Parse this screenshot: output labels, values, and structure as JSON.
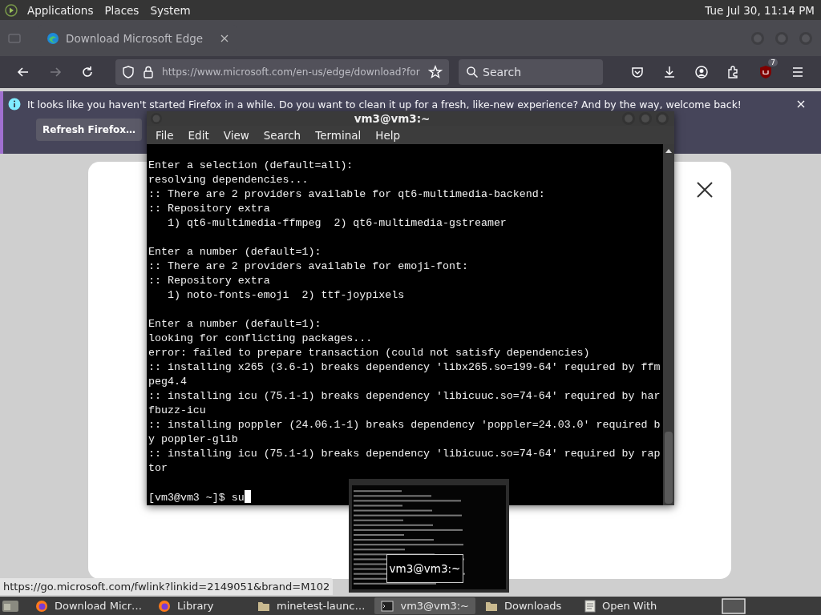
{
  "top_panel": {
    "menus": [
      "Applications",
      "Places",
      "System"
    ],
    "clock": "Tue Jul 30, 11:14 PM"
  },
  "browser": {
    "tabs": [
      {
        "title": "Download Microsoft Edge",
        "selected": true
      }
    ],
    "url": "https://www.microsoft.com/en-us/edge/download?for",
    "search": {
      "placeholder": "Search"
    },
    "forward_disabled": true,
    "extension_badge": "7",
    "notification": {
      "message": "It looks like you haven't started Firefox in a while. Do you want to clean it up for a fresh, like-new experience? And by the way, welcome back!",
      "button": "Refresh Firefox…"
    },
    "status_url": "https://go.microsoft.com/fwlink?linkid=2149051&brand=M102"
  },
  "terminal": {
    "title": "vm3@vm3:~",
    "menus": [
      "File",
      "Edit",
      "View",
      "Search",
      "Terminal",
      "Help"
    ],
    "blocks": [
      [
        "Enter a selection (default=all):",
        "resolving dependencies...",
        ":: There are 2 providers available for qt6-multimedia-backend:",
        ":: Repository extra",
        "   1) qt6-multimedia-ffmpeg  2) qt6-multimedia-gstreamer"
      ],
      [
        "Enter a number (default=1):",
        ":: There are 2 providers available for emoji-font:",
        ":: Repository extra",
        "   1) noto-fonts-emoji  2) ttf-joypixels"
      ],
      [
        "Enter a number (default=1):",
        "looking for conflicting packages...",
        "error: failed to prepare transaction (could not satisfy dependencies)",
        ":: installing x265 (3.6-1) breaks dependency 'libx265.so=199-64' required by ffm",
        "peg4.4",
        ":: installing icu (75.1-1) breaks dependency 'libicuuc.so=74-64' required by har",
        "fbuzz-icu",
        ":: installing poppler (24.06.1-1) breaks dependency 'poppler=24.03.0' required b",
        "y poppler-glib",
        ":: installing icu (75.1-1) breaks dependency 'libicuuc.so=74-64' required by rap",
        "tor"
      ]
    ],
    "prompt": "[vm3@vm3 ~]$ ",
    "input": "su"
  },
  "switcher_preview": {
    "label": "vm3@vm3:~"
  },
  "taskbar": {
    "items": [
      {
        "label": "Download Micr…",
        "kind": "firefox",
        "selected": false
      },
      {
        "label": "Library",
        "kind": "firefox",
        "selected": false
      },
      {
        "label": "minetest-launc…",
        "kind": "folder",
        "selected": false
      },
      {
        "label": "vm3@vm3:~",
        "kind": "terminal",
        "selected": true
      },
      {
        "label": "Downloads",
        "kind": "folder",
        "selected": false
      },
      {
        "label": "Open With",
        "kind": "document",
        "selected": false
      }
    ]
  }
}
